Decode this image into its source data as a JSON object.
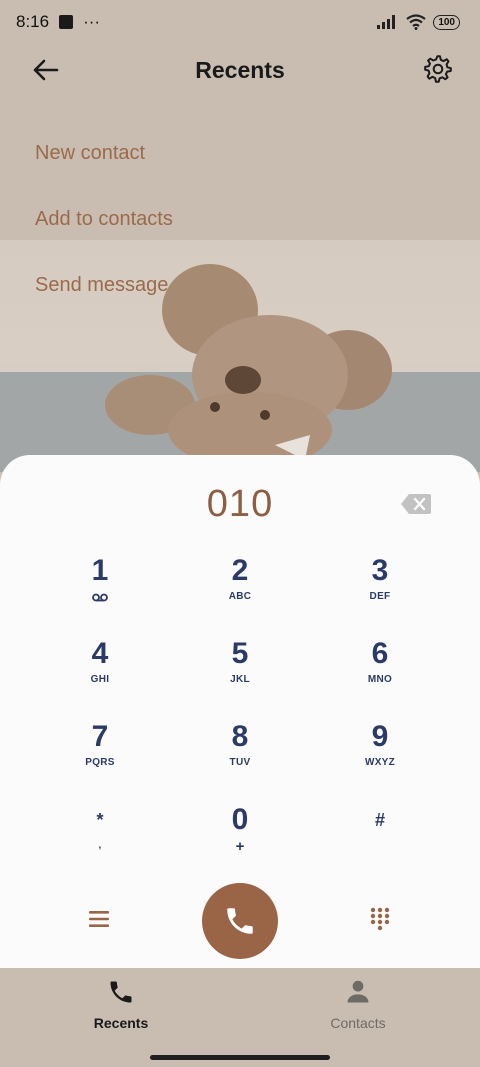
{
  "status_bar": {
    "time": "8:16",
    "more": "···",
    "battery": "100"
  },
  "header": {
    "title": "Recents"
  },
  "actions": [
    "New contact",
    "Add to contacts",
    "Send message"
  ],
  "dialer": {
    "number": "010",
    "keys": [
      {
        "digit": "1",
        "letters": ""
      },
      {
        "digit": "2",
        "letters": "ABC"
      },
      {
        "digit": "3",
        "letters": "DEF"
      },
      {
        "digit": "4",
        "letters": "GHI"
      },
      {
        "digit": "5",
        "letters": "JKL"
      },
      {
        "digit": "6",
        "letters": "MNO"
      },
      {
        "digit": "7",
        "letters": "PQRS"
      },
      {
        "digit": "8",
        "letters": "TUV"
      },
      {
        "digit": "9",
        "letters": "WXYZ"
      },
      {
        "digit": "*",
        "letters": ","
      },
      {
        "digit": "0",
        "letters": "+"
      },
      {
        "digit": "#",
        "letters": ""
      }
    ]
  },
  "nav": {
    "recents": "Recents",
    "contacts": "Contacts"
  },
  "colors": {
    "accent": "#9a6547",
    "key_text": "#2b3a66",
    "action_text": "#9b6a4b"
  }
}
